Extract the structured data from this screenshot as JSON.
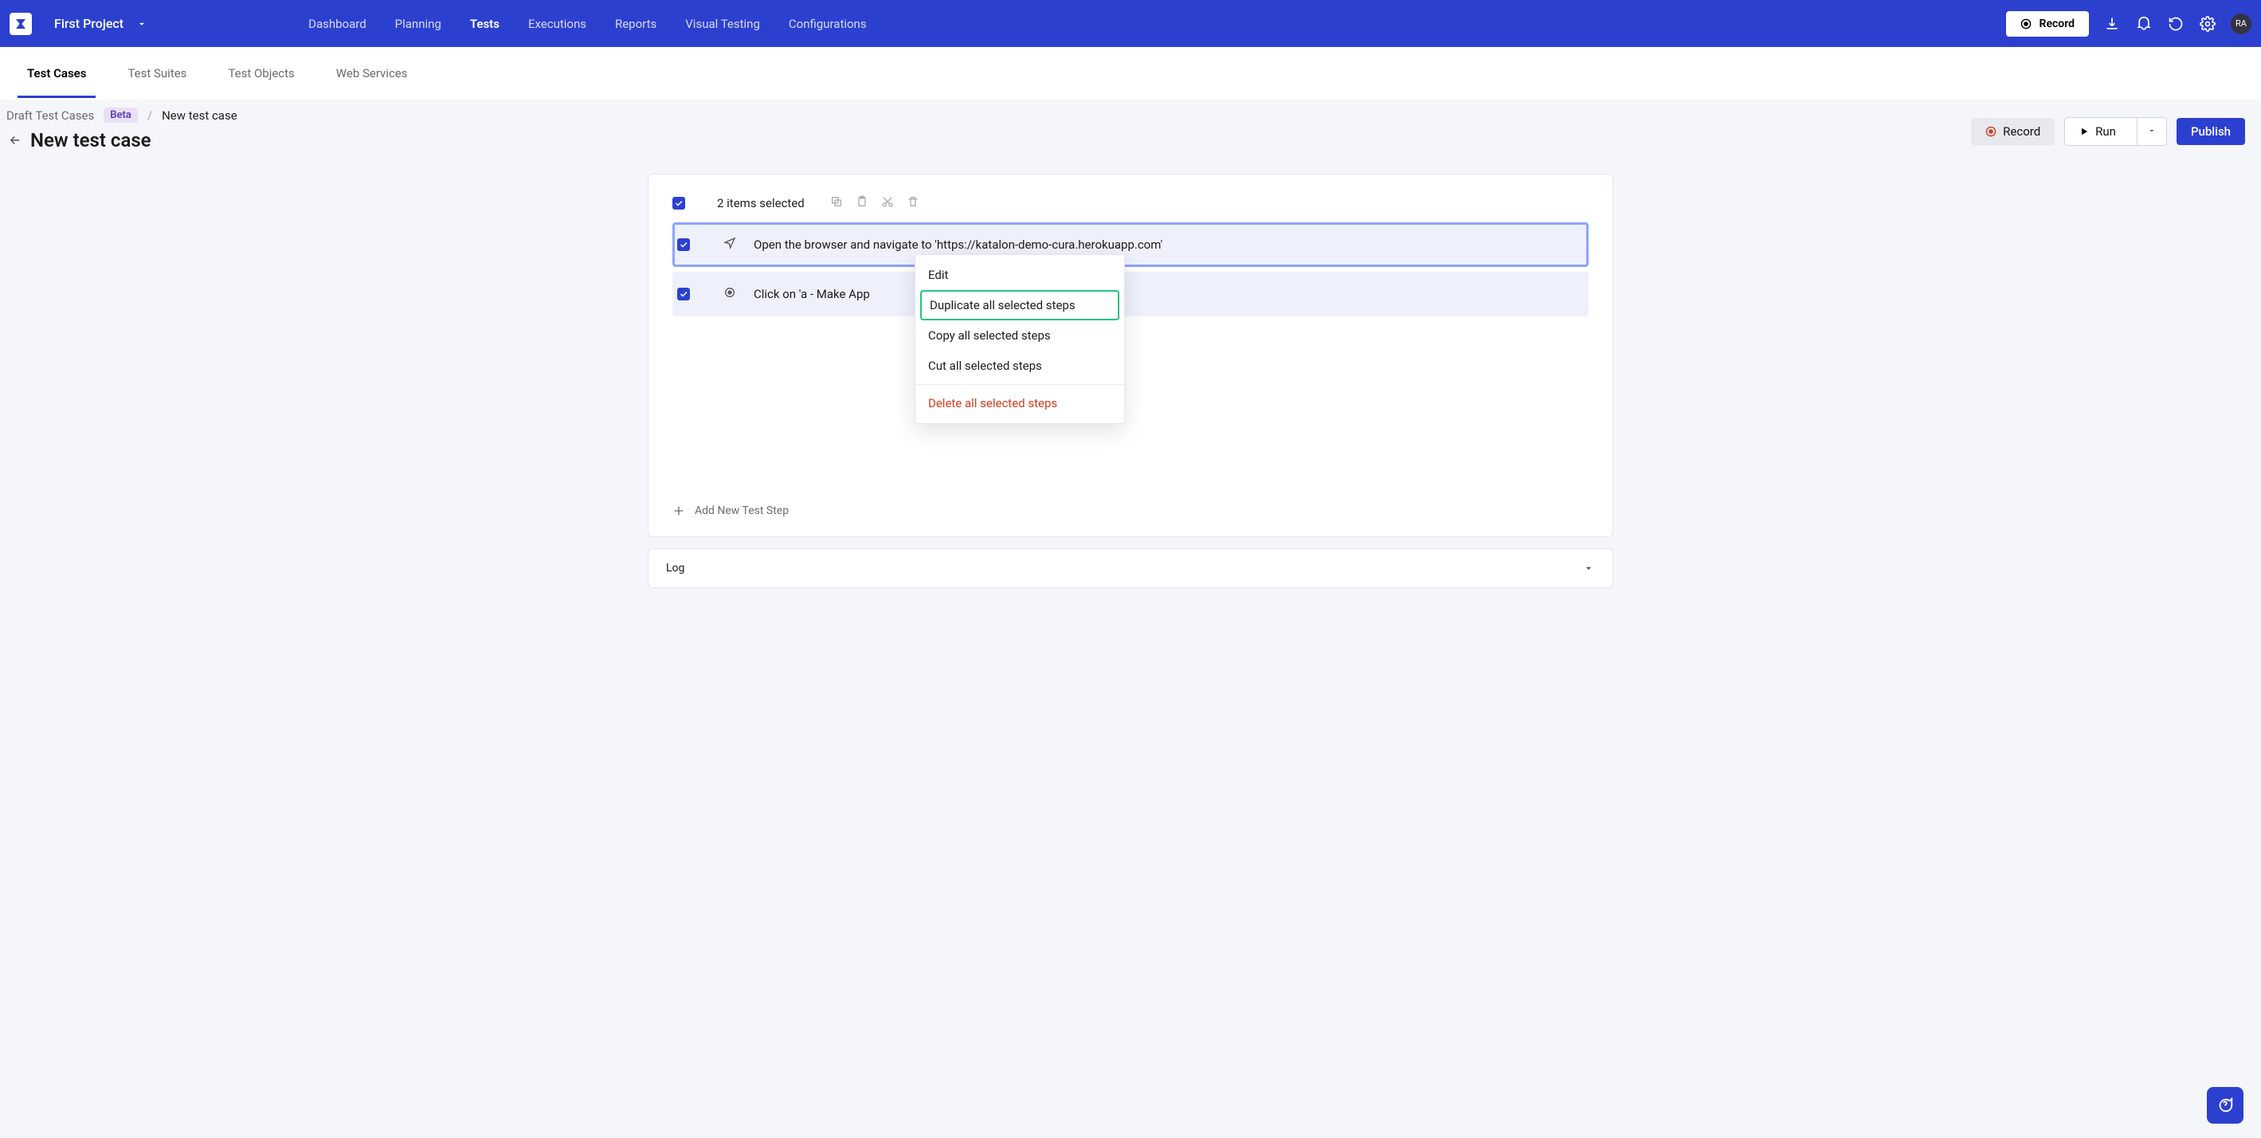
{
  "header": {
    "project_name": "First Project",
    "nav": [
      "Dashboard",
      "Planning",
      "Tests",
      "Executions",
      "Reports",
      "Visual Testing",
      "Configurations"
    ],
    "active_nav_index": 2,
    "record_label": "Record",
    "avatar_initials": "RA"
  },
  "sub_tabs": {
    "items": [
      "Test Cases",
      "Test Suites",
      "Test Objects",
      "Web Services"
    ],
    "active_index": 0
  },
  "breadcrumb": {
    "root": "Draft Test Cases",
    "badge": "Beta",
    "current": "New test case"
  },
  "page": {
    "title": "New test case",
    "actions": {
      "record": "Record",
      "run": "Run",
      "publish": "Publish"
    }
  },
  "selection": {
    "summary": "2 items selected"
  },
  "steps": [
    {
      "text": "Open the browser and navigate to 'https://katalon-demo-cura.herokuapp.com'",
      "icon": "navigate"
    },
    {
      "text": "Click on 'a - Make App",
      "icon": "click"
    }
  ],
  "add_step_label": "Add New Test Step",
  "context_menu": {
    "edit": "Edit",
    "duplicate": "Duplicate all selected steps",
    "copy": "Copy all selected steps",
    "cut": "Cut all selected steps",
    "delete": "Delete all selected steps"
  },
  "log": {
    "title": "Log"
  }
}
